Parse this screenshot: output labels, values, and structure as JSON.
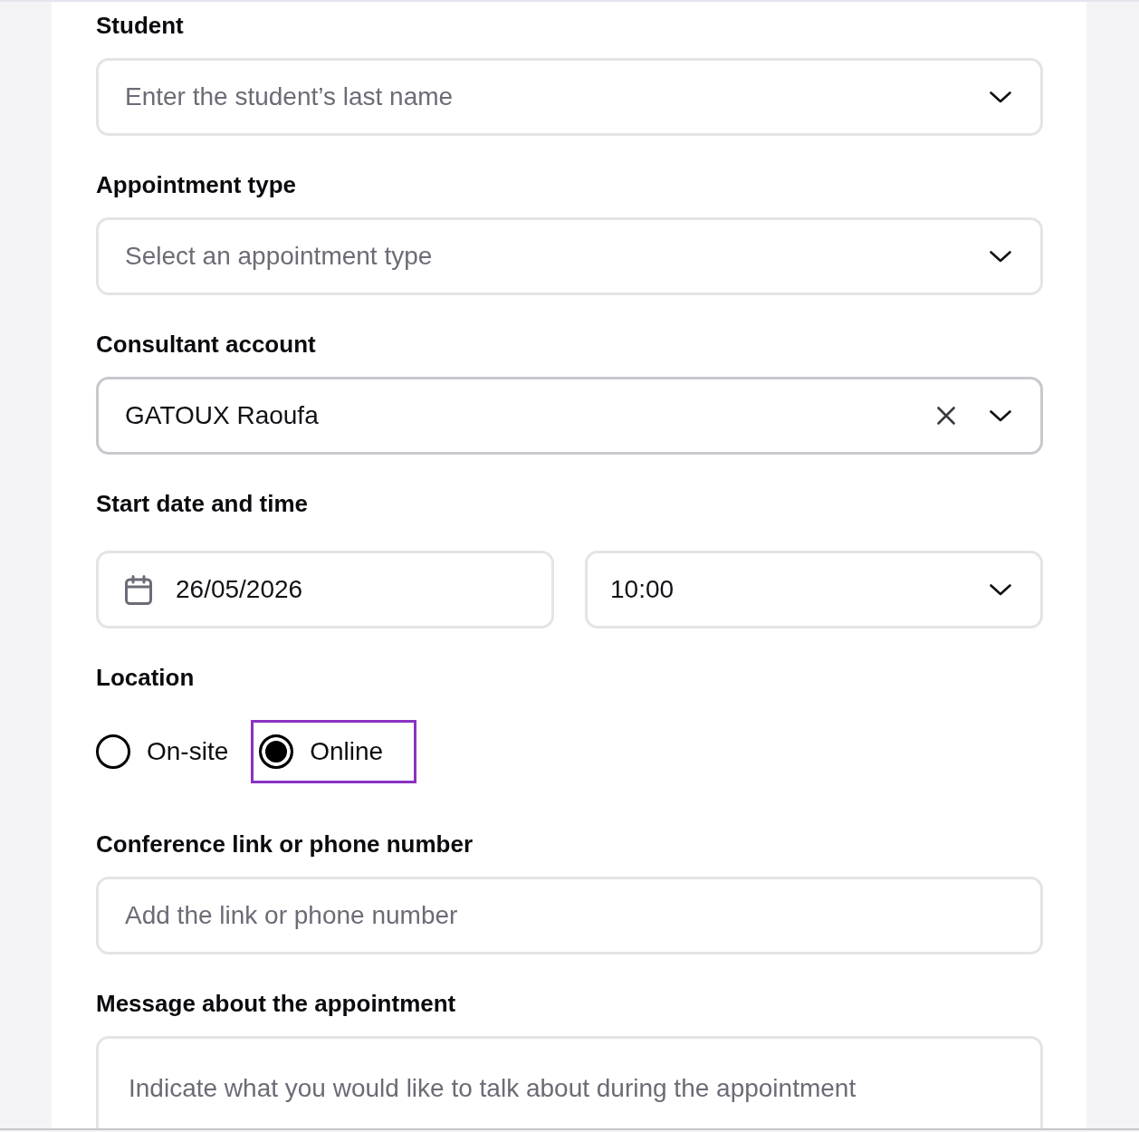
{
  "sections": [
    {
      "kind": "select",
      "label": "Student",
      "placeholder": "Enter the student’s last name",
      "hovered": false
    },
    {
      "kind": "select",
      "label": "Appointment type",
      "placeholder": "Select an appointment type",
      "hovered": false
    },
    {
      "kind": "select",
      "label": "Consultant account",
      "value": "GATOUX Raoufa",
      "hovered": true,
      "clearable": true
    },
    {
      "kind": "datetime",
      "label": "Start date and time",
      "date": "26/05/2026",
      "time": "10:00"
    },
    {
      "kind": "radio",
      "label": "Location",
      "options": [
        {
          "label": "On-site",
          "selected": false,
          "focused": false
        },
        {
          "label": "Online",
          "selected": true,
          "focused": true
        }
      ]
    },
    {
      "kind": "text",
      "label": "Conference link or phone number",
      "placeholder": "Add the link or phone number"
    },
    {
      "kind": "textarea",
      "label": "Message about the appointment",
      "placeholder": "Indicate what you would like to talk about during the appointment"
    }
  ]
}
